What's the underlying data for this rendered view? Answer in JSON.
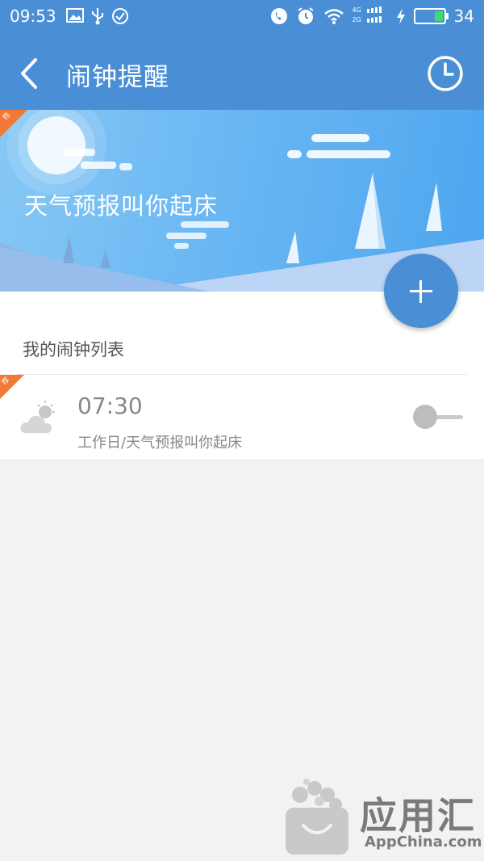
{
  "status_bar": {
    "time": "09:53",
    "battery_level": "34",
    "network_top": "4G",
    "network_bottom": "2G",
    "icons": [
      "image-icon",
      "usb-icon",
      "check-circle-icon",
      "phone-icon",
      "alarm-icon",
      "wifi-icon",
      "signal-icon",
      "charging-icon",
      "battery-icon"
    ]
  },
  "header": {
    "title": "闹钟提醒",
    "back_icon": "back-arrow-icon",
    "history_icon": "clock-icon"
  },
  "banner": {
    "headline": "天气预报叫你起床",
    "tag": "热"
  },
  "fab": {
    "icon": "plus-icon"
  },
  "list": {
    "header": "我的闹钟列表",
    "items": [
      {
        "tag": "荐",
        "time": "07:30",
        "description": "工作日/天气预报叫你起床",
        "weather_icon": "partly-cloudy-icon",
        "enabled": false
      }
    ]
  },
  "watermark": {
    "name": "应用汇",
    "sub": "AppChina.com"
  },
  "colors": {
    "primary": "#4a8fd6",
    "tag_orange": "#f07a35",
    "background": "#f2f2f2"
  }
}
